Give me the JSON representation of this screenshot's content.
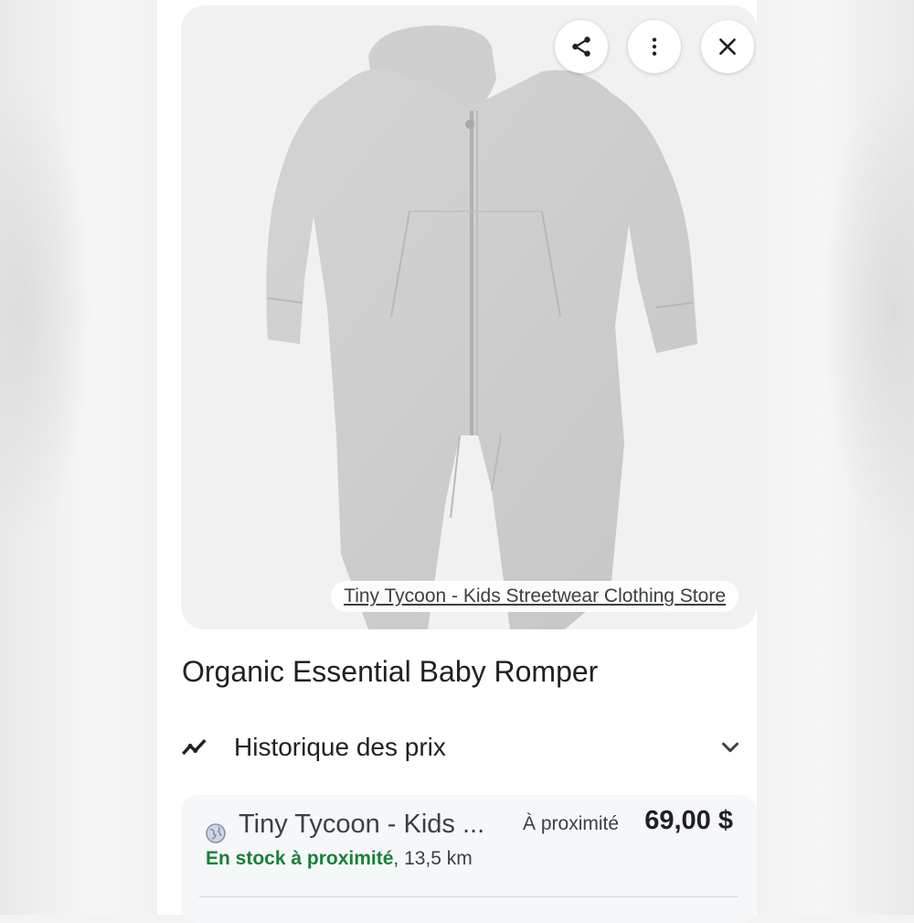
{
  "image_card": {
    "source_label": "Tiny Tycoon - Kids Streetwear Clothing Store",
    "share_icon": "share-icon",
    "more_icon": "more-vert-icon",
    "close_icon": "close-icon"
  },
  "product": {
    "title": "Organic Essential Baby Romper"
  },
  "price_history": {
    "label": "Historique des prix",
    "icon": "trend-icon",
    "chevron": "chevron-down-icon"
  },
  "offer": {
    "store": "Tiny Tycoon - Kids ...",
    "nearby": "À proximité",
    "price": "69,00 $",
    "stock": "En stock à proximité",
    "distance": ", 13,5 km"
  },
  "colors": {
    "stock_green": "#188038",
    "text": "#202124"
  }
}
